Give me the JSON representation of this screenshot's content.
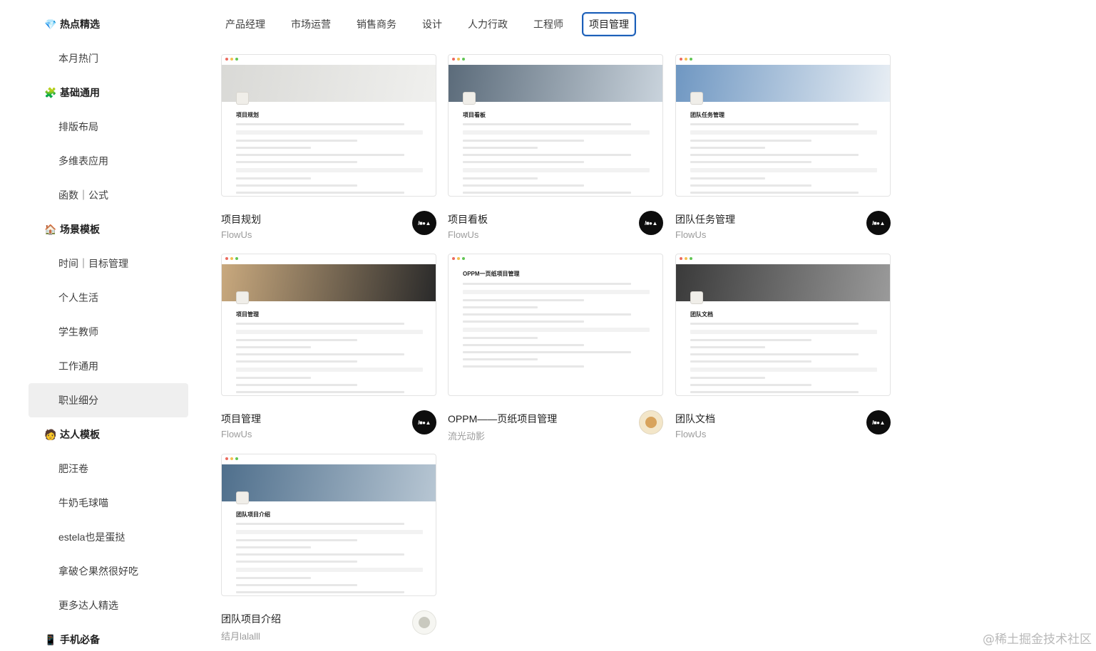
{
  "sidebar": [
    {
      "type": "section",
      "icon": "💎",
      "icon_name": "gem-icon",
      "label": "热点精选"
    },
    {
      "type": "item",
      "label": "本月热门"
    },
    {
      "type": "section",
      "icon": "🧩",
      "icon_name": "puzzle-icon",
      "label": "基础通用"
    },
    {
      "type": "item",
      "label": "排版布局"
    },
    {
      "type": "item",
      "label": "多维表应用"
    },
    {
      "type": "item",
      "label": "函数｜公式"
    },
    {
      "type": "section",
      "icon": "🏠",
      "icon_name": "house-icon",
      "label": "场景模板"
    },
    {
      "type": "item",
      "label": "时间｜目标管理"
    },
    {
      "type": "item",
      "label": "个人生活"
    },
    {
      "type": "item",
      "label": "学生教师"
    },
    {
      "type": "item",
      "label": "工作通用"
    },
    {
      "type": "item",
      "label": "职业细分",
      "active": true
    },
    {
      "type": "section",
      "icon": "🧑",
      "icon_name": "person-icon",
      "label": "达人模板"
    },
    {
      "type": "item",
      "label": "肥汪卷"
    },
    {
      "type": "item",
      "label": "牛奶毛球喵"
    },
    {
      "type": "item",
      "label": "estela也是蛋挞"
    },
    {
      "type": "item",
      "label": "拿破仑果然很好吃"
    },
    {
      "type": "item",
      "label": "更多达人精选"
    },
    {
      "type": "section",
      "icon": "📱",
      "icon_name": "phone-icon",
      "label": "手机必备"
    }
  ],
  "tabs": [
    {
      "label": "产品经理"
    },
    {
      "label": "市场运营"
    },
    {
      "label": "销售商务"
    },
    {
      "label": "设计"
    },
    {
      "label": "人力行政"
    },
    {
      "label": "工程师"
    },
    {
      "label": "项目管理",
      "active": true
    }
  ],
  "cards": [
    {
      "title": "项目规划",
      "author": "FlowUs",
      "doc_title": "项目规划",
      "avatar": "flowus",
      "cover": "#d9d9d6",
      "cover2": "#f0f0ee"
    },
    {
      "title": "项目看板",
      "author": "FlowUs",
      "doc_title": "项目看板",
      "avatar": "flowus",
      "cover": "#5b6b7a",
      "cover2": "#c9d3dc"
    },
    {
      "title": "团队任务管理",
      "author": "FlowUs",
      "doc_title": "团队任务管理",
      "avatar": "flowus",
      "cover": "#6f97c2",
      "cover2": "#e8eef4"
    },
    {
      "title": "项目管理",
      "author": "FlowUs",
      "doc_title": "项目管理",
      "avatar": "flowus",
      "cover": "#c9a97e",
      "cover2": "#2a2a2a"
    },
    {
      "title": "OPPM——页纸项目管理",
      "author": "流光动影",
      "doc_title": "OPPM一页纸项目管理",
      "avatar": "person",
      "cover": "#ffffff",
      "cover2": "#ffffff"
    },
    {
      "title": "团队文档",
      "author": "FlowUs",
      "doc_title": "团队文档",
      "avatar": "flowus",
      "cover": "#3a3a3a",
      "cover2": "#9a9a9a"
    },
    {
      "title": "团队项目介绍",
      "author": "结月lalalll",
      "doc_title": "团队项目介绍",
      "avatar": "cat",
      "cover": "#4f6f8c",
      "cover2": "#b7c6d3"
    }
  ],
  "avatar_logo_text": "/■●▲",
  "watermark": "@稀土掘金技术社区"
}
